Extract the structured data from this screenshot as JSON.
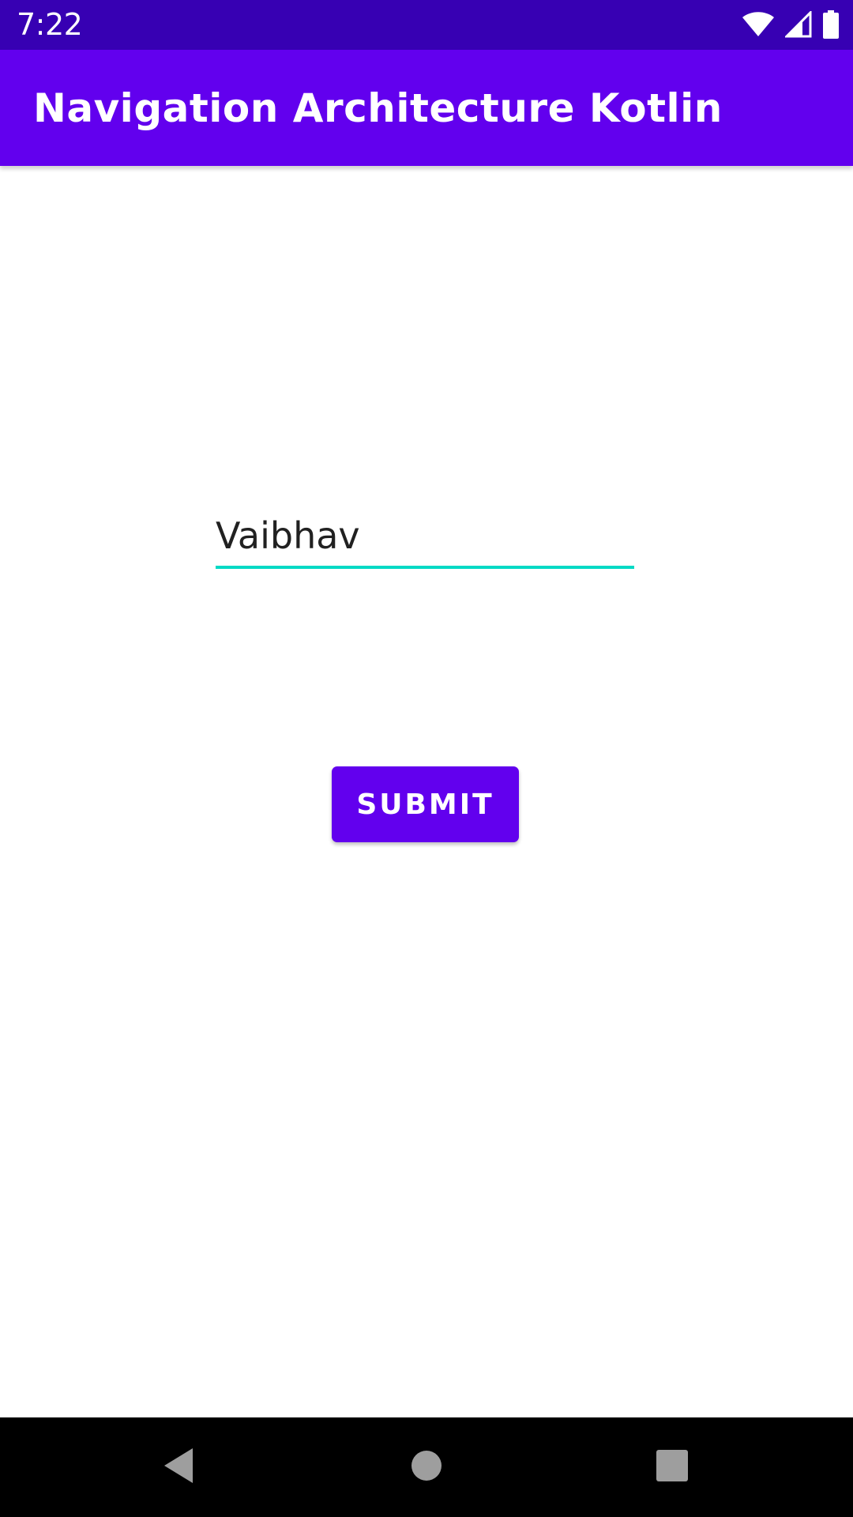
{
  "status_bar": {
    "time": "7:22",
    "icons": [
      "wifi-icon",
      "cellular-signal-icon",
      "battery-icon"
    ]
  },
  "app_bar": {
    "title": "Navigation Architecture Kotlin",
    "color": "#6200EE"
  },
  "form": {
    "name_value": "Vaibhav",
    "underline_color": "#03DAC5",
    "submit_label": "SUBMIT"
  },
  "nav_bar": {
    "icons": [
      "back-icon",
      "home-icon",
      "recents-icon"
    ]
  },
  "colors": {
    "status_bar": "#3700B3",
    "primary": "#6200EE",
    "accent": "#03DAC5"
  }
}
